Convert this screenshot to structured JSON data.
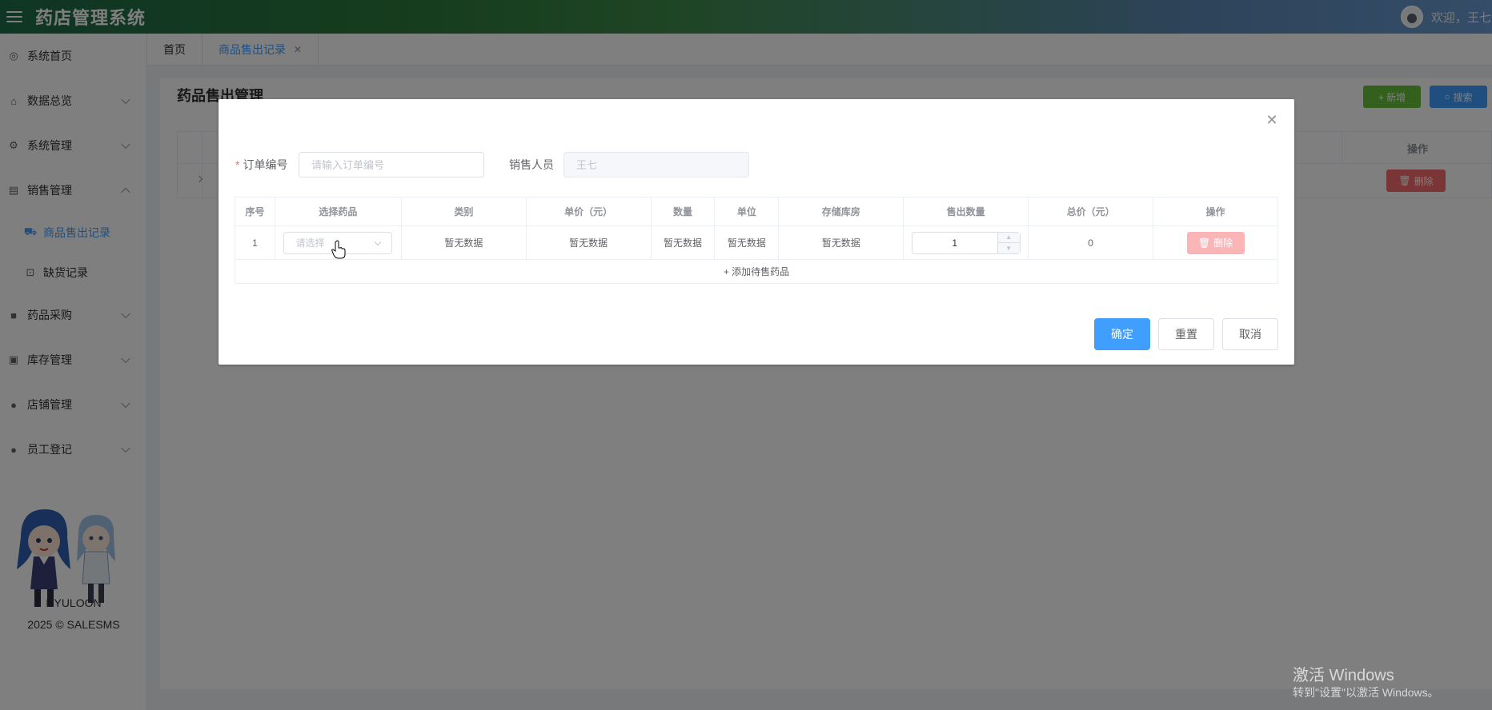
{
  "header": {
    "title": "药店管理系统",
    "welcome": "欢迎，王七"
  },
  "sidebar": {
    "items": [
      {
        "label": "系统首页",
        "icon": "home-outline-icon"
      },
      {
        "label": "数据总览",
        "icon": "house-icon"
      },
      {
        "label": "系统管理",
        "icon": "gear-icon"
      },
      {
        "label": "销售管理",
        "icon": "chart-icon"
      },
      {
        "label": "药品采购",
        "icon": "bag-icon"
      },
      {
        "label": "库存管理",
        "icon": "briefcase-icon"
      },
      {
        "label": "店铺管理",
        "icon": "user-icon"
      },
      {
        "label": "员工登记",
        "icon": "user-icon"
      }
    ],
    "subitems": [
      {
        "label": "商品售出记录",
        "icon": "truck-icon"
      },
      {
        "label": "缺货记录",
        "icon": "bag-outline-icon"
      }
    ],
    "brand": "DYULOON",
    "copyright": "2025 © SALESMS"
  },
  "tabs": [
    {
      "label": "首页"
    },
    {
      "label": "商品售出记录"
    }
  ],
  "page": {
    "title": "药品售出管理",
    "add_label": "+ 新增",
    "search_label": "搜索",
    "op_header": "操作",
    "delete_label": "删除"
  },
  "dialog": {
    "order_label": "订单编号",
    "order_placeholder": "请输入订单编号",
    "seller_label": "销售人员",
    "seller_value": "王七",
    "columns": [
      "序号",
      "选择药品",
      "类别",
      "单价（元）",
      "数量",
      "单位",
      "存储库房",
      "售出数量",
      "总价（元）",
      "操作"
    ],
    "row": {
      "index": "1",
      "select_placeholder": "请选择",
      "category": "暂无数据",
      "price": "暂无数据",
      "qty": "暂无数据",
      "unit": "暂无数据",
      "warehouse": "暂无数据",
      "sold_qty": "1",
      "total": "0",
      "delete_label": "删除"
    },
    "add_row_label": "+ 添加待售药品",
    "confirm_label": "确定",
    "reset_label": "重置",
    "cancel_label": "取消"
  },
  "watermark": {
    "line1": "激活 Windows",
    "line2": "转到\"设置\"以激活 Windows。"
  },
  "colors": {
    "primary": "#409eff",
    "success": "#67c23a",
    "danger": "#f56c6c",
    "header_start": "#1f6b49",
    "header_end": "#6a9ad0"
  }
}
